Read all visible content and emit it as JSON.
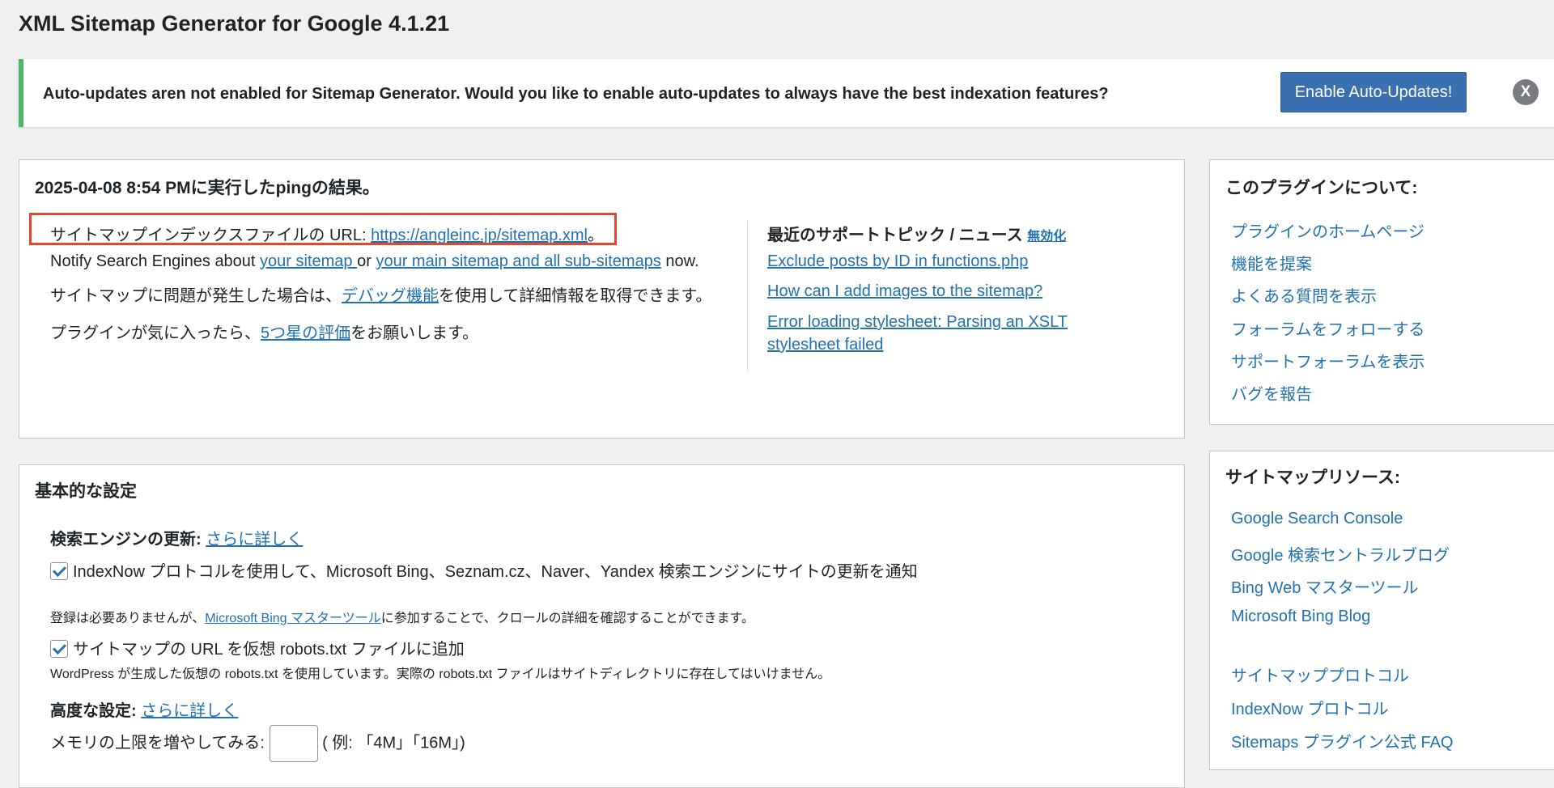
{
  "page": {
    "title": "XML Sitemap Generator for Google 4.1.21"
  },
  "notice": {
    "text": "Auto-updates aren not enabled for Sitemap Generator. Would you like to enable auto-updates to always have the best indexation features?",
    "button": "Enable Auto-Updates!",
    "close": "X"
  },
  "ping_box": {
    "title": "2025-04-08 8:54 PMに実行したpingの結果。",
    "index_label": "サイトマップインデックスファイルの URL: ",
    "index_url": "https://angleinc.jp/sitemap.xml",
    "index_suffix": "。",
    "notify_prefix": "Notify Search Engines about ",
    "notify_link1": "your sitemap ",
    "notify_or": "or ",
    "notify_link2": "your main sitemap and all sub-sitemaps",
    "notify_suffix": " now.",
    "debug_prefix": "サイトマップに問題が発生した場合は、",
    "debug_link": "デバッグ機能",
    "debug_suffix": "を使用して詳細情報を取得できます。",
    "rate_prefix": "プラグインが気に入ったら、",
    "rate_link": "5つ星の評価",
    "rate_suffix": "をお願いします。",
    "news_title": "最近のサポートトピック / ニュース",
    "news_disable": "無効化",
    "news_items": [
      "Exclude posts by ID in functions.php",
      "How can I add images to the sitemap?",
      "Error loading stylesheet: Parsing an XSLT",
      "stylesheet failed"
    ]
  },
  "basic_box": {
    "title": "基本的な設定",
    "search_update_label": "検索エンジンの更新: ",
    "search_update_link": "さらに詳しく",
    "indexnow_label": "IndexNow プロトコルを使用して、Microsoft Bing、Seznam.cz、Naver、Yandex 検索エンジンにサイトの更新を通知",
    "bing_note_prefix": "登録は必要ありませんが、",
    "bing_note_link": "Microsoft Bing マスターツール",
    "bing_note_suffix": "に参加することで、クロールの詳細を確認することができます。",
    "robots_label": "サイトマップの URL を仮想 robots.txt ファイルに追加",
    "robots_note": "WordPress が生成した仮想の robots.txt を使用しています。実際の robots.txt ファイルはサイトディレクトリに存在してはいけません。",
    "advanced_label": "高度な設定: ",
    "advanced_link": "さらに詳しく",
    "memory_label": "メモリの上限を増やしてみる: ",
    "memory_example": " ( 例: 「4M」「16M」)"
  },
  "about_box": {
    "title": "このプラグインについて:",
    "links": [
      "プラグインのホームページ",
      "機能を提案",
      "よくある質問を表示",
      "フォーラムをフォローする",
      "サポートフォーラムを表示",
      "バグを報告"
    ]
  },
  "resources_box": {
    "title": "サイトマップリソース:",
    "links": [
      "Google Search Console",
      "Google 検索セントラルブログ",
      "Bing Web マスターツール",
      "Microsoft Bing Blog"
    ],
    "links2": [
      "サイトマッププロトコル",
      "IndexNow プロトコル",
      "Sitemaps プラグイン公式 FAQ"
    ]
  }
}
